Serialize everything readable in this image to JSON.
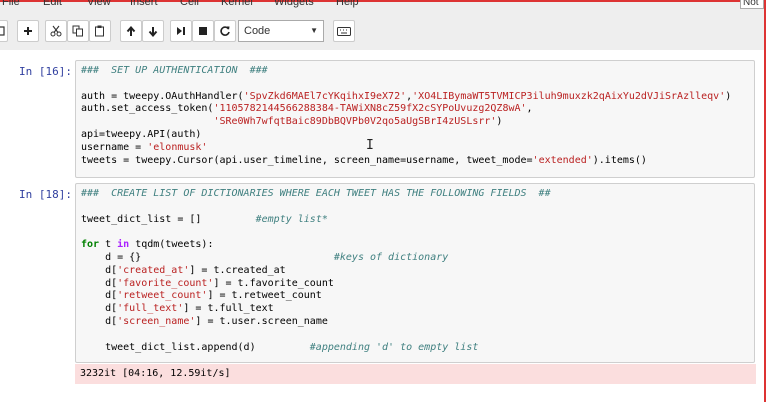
{
  "menubar": {
    "items": [
      "File",
      "Edit",
      "View",
      "Insert",
      "Cell",
      "Kernel",
      "Widgets",
      "Help"
    ],
    "right_box": "Not"
  },
  "toolbar": {
    "cell_type": "Code",
    "icons": [
      "save-icon",
      "plus-icon",
      "cut-icon",
      "copy-icon",
      "paste-icon",
      "arrow-up-icon",
      "arrow-down-icon",
      "step-run-icon",
      "stop-icon",
      "restart-icon",
      "keyboard-icon"
    ]
  },
  "cells": [
    {
      "prompt": "In [16]:",
      "lines": [
        [
          [
            "c-com",
            "###  SET UP AUTHENTICATION  ###"
          ]
        ],
        [
          [
            "",
            ""
          ]
        ],
        [
          [
            "",
            "auth = tweepy.OAuthHandler("
          ],
          [
            "c-str",
            "'SpvZkd6MAEl7cYKqihxI9eX72'"
          ],
          [
            "",
            ","
          ],
          [
            "c-str",
            "'XO4LIBymaWT5TVMICP3iluh9muxzk2qAixYu2dVJiSrAzlleqv'"
          ],
          [
            "",
            ")"
          ]
        ],
        [
          [
            "",
            "auth.set_access_token("
          ],
          [
            "c-str",
            "'1105782144566288384-TAWiXN8cZ59fX2cSYPoUvuzg2QZ8wA'"
          ],
          [
            "",
            ","
          ]
        ],
        [
          [
            "",
            "                      "
          ],
          [
            "c-str",
            "'SRe0Wh7wfqtBaic89DbBQVPb0V2qo5aUgSBrI4zUSLsrr'"
          ],
          [
            "",
            ")"
          ]
        ],
        [
          [
            "",
            "api=tweepy.API(auth)"
          ]
        ],
        [
          [
            "",
            "username = "
          ],
          [
            "c-str",
            "'elonmusk'"
          ]
        ],
        [
          [
            "",
            "tweets = tweepy.Cursor(api.user_timeline, screen_name=username, tweet_mode="
          ],
          [
            "c-str",
            "'extended'"
          ],
          [
            "",
            ").items()"
          ]
        ]
      ]
    },
    {
      "prompt": "In [18]:",
      "lines": [
        [
          [
            "c-com",
            "###  CREATE LIST OF DICTIONARIES WHERE EACH TWEET HAS THE FOLLOWING FIELDS  ##"
          ]
        ],
        [
          [
            "",
            ""
          ]
        ],
        [
          [
            "",
            "tweet_dict_list = []         "
          ],
          [
            "c-com",
            "#empty list*"
          ]
        ],
        [
          [
            "",
            ""
          ]
        ],
        [
          [
            "c-kw",
            "for"
          ],
          [
            "",
            " t "
          ],
          [
            "c-op",
            "in"
          ],
          [
            "",
            " tqdm(tweets):"
          ]
        ],
        [
          [
            "",
            "    d = {}                                "
          ],
          [
            "c-com",
            "#keys of dictionary"
          ]
        ],
        [
          [
            "",
            "    d["
          ],
          [
            "c-str",
            "'created_at'"
          ],
          [
            "",
            "] = t.created_at"
          ]
        ],
        [
          [
            "",
            "    d["
          ],
          [
            "c-str",
            "'favorite_count'"
          ],
          [
            "",
            "] = t.favorite_count"
          ]
        ],
        [
          [
            "",
            "    d["
          ],
          [
            "c-str",
            "'retweet_count'"
          ],
          [
            "",
            "] = t.retweet_count"
          ]
        ],
        [
          [
            "",
            "    d["
          ],
          [
            "c-str",
            "'full_text'"
          ],
          [
            "",
            "] = t.full_text"
          ]
        ],
        [
          [
            "",
            "    d["
          ],
          [
            "c-str",
            "'screen_name'"
          ],
          [
            "",
            "] = t.user.screen_name"
          ]
        ],
        [
          [
            "",
            ""
          ]
        ],
        [
          [
            "",
            "    tweet_dict_list.append(d)         "
          ],
          [
            "c-com",
            "#appending 'd' to empty list"
          ]
        ]
      ],
      "output": "3232it [04:16, 12.59it/s]"
    }
  ]
}
